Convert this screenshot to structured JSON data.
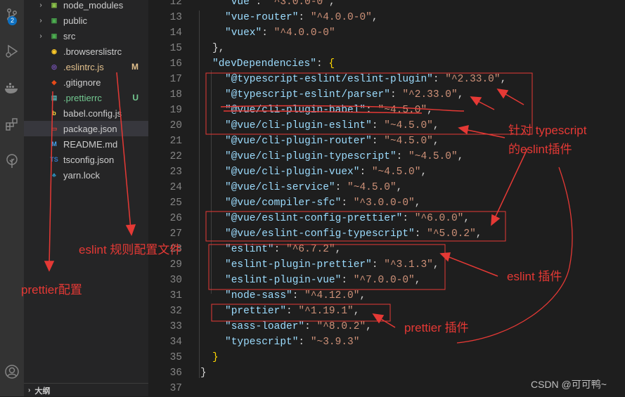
{
  "activity_bar": {
    "scm_badge": "2",
    "icons": [
      "source-control-icon",
      "run-debug-icon",
      "docker-icon",
      "extensions-icon",
      "tree-icon",
      "account-icon"
    ]
  },
  "explorer": {
    "items": [
      {
        "name": "node_modules",
        "type": "folder",
        "status": ""
      },
      {
        "name": "public",
        "type": "folder",
        "status": ""
      },
      {
        "name": "src",
        "type": "folder",
        "status": ""
      },
      {
        "name": ".browserslistrc",
        "type": "file",
        "status": ""
      },
      {
        "name": ".eslintrc.js",
        "type": "file",
        "status": "M"
      },
      {
        "name": ".gitignore",
        "type": "file",
        "status": ""
      },
      {
        "name": ".prettierrc",
        "type": "file",
        "status": "U"
      },
      {
        "name": "babel.config.js",
        "type": "file",
        "status": ""
      },
      {
        "name": "package.json",
        "type": "file",
        "status": ""
      },
      {
        "name": "README.md",
        "type": "file",
        "status": ""
      },
      {
        "name": "tsconfig.json",
        "type": "file",
        "status": ""
      },
      {
        "name": "yarn.lock",
        "type": "file",
        "status": ""
      }
    ],
    "outline_label": "大纲",
    "colors": {
      "modified": "#e2c08d",
      "untracked": "#73c991",
      "prettierrc_name": "#73c991"
    }
  },
  "editor": {
    "lines": [
      {
        "num": "12",
        "key": "\"vue\"",
        "value": "\"^3.0.0-0\"",
        "trail": ","
      },
      {
        "num": "13",
        "key": "\"vue-router\"",
        "value": "\"^4.0.0-0\"",
        "trail": ","
      },
      {
        "num": "14",
        "key": "\"vuex\"",
        "value": "\"^4.0.0-0\"",
        "trail": ""
      },
      {
        "num": "15",
        "text": "},"
      },
      {
        "num": "16",
        "key": "\"devDependencies\"",
        "value": "{",
        "trail": ""
      },
      {
        "num": "17",
        "key": "\"@typescript-eslint/eslint-plugin\"",
        "value": "\"^2.33.0\"",
        "trail": ","
      },
      {
        "num": "18",
        "key": "\"@typescript-eslint/parser\"",
        "value": "\"^2.33.0\"",
        "trail": ","
      },
      {
        "num": "19",
        "key": "\"@vue/cli-plugin-babel\"",
        "value": "\"~4.5.0\"",
        "trail": ","
      },
      {
        "num": "20",
        "key": "\"@vue/cli-plugin-eslint\"",
        "value": "\"~4.5.0\"",
        "trail": ","
      },
      {
        "num": "21",
        "key": "\"@vue/cli-plugin-router\"",
        "value": "\"~4.5.0\"",
        "trail": ","
      },
      {
        "num": "22",
        "key": "\"@vue/cli-plugin-typescript\"",
        "value": "\"~4.5.0\"",
        "trail": ","
      },
      {
        "num": "23",
        "key": "\"@vue/cli-plugin-vuex\"",
        "value": "\"~4.5.0\"",
        "trail": ","
      },
      {
        "num": "24",
        "key": "\"@vue/cli-service\"",
        "value": "\"~4.5.0\"",
        "trail": ","
      },
      {
        "num": "25",
        "key": "\"@vue/compiler-sfc\"",
        "value": "\"^3.0.0-0\"",
        "trail": ","
      },
      {
        "num": "26",
        "key": "\"@vue/eslint-config-prettier\"",
        "value": "\"^6.0.0\"",
        "trail": ","
      },
      {
        "num": "27",
        "key": "\"@vue/eslint-config-typescript\"",
        "value": "\"^5.0.2\"",
        "trail": ","
      },
      {
        "num": "28",
        "key": "\"eslint\"",
        "value": "\"^6.7.2\"",
        "trail": ","
      },
      {
        "num": "29",
        "key": "\"eslint-plugin-prettier\"",
        "value": "\"^3.1.3\"",
        "trail": ","
      },
      {
        "num": "30",
        "key": "\"eslint-plugin-vue\"",
        "value": "\"^7.0.0-0\"",
        "trail": ","
      },
      {
        "num": "31",
        "key": "\"node-sass\"",
        "value": "\"^4.12.0\"",
        "trail": ","
      },
      {
        "num": "32",
        "key": "\"prettier\"",
        "value": "\"^1.19.1\"",
        "trail": ","
      },
      {
        "num": "33",
        "key": "\"sass-loader\"",
        "value": "\"^8.0.2\"",
        "trail": ","
      },
      {
        "num": "34",
        "key": "\"typescript\"",
        "value": "\"~3.9.3\"",
        "trail": ""
      },
      {
        "num": "35",
        "text": "}"
      },
      {
        "num": "36",
        "text": "}"
      },
      {
        "num": "37",
        "text": ""
      }
    ],
    "colors": {
      "key": "#9cdcfe",
      "string": "#ce9178",
      "punct": "#d4d4d4",
      "bracket": "#ffd700",
      "line_number": "#858585"
    }
  },
  "annotations": {
    "ts_eslint_line1": "针对 typescript",
    "ts_eslint_line2": "的eslint插件",
    "eslint_rules_file": "eslint 规则配置文件",
    "prettier_config": "prettier配置",
    "eslint_plugin": "eslint 插件",
    "prettier_plugin": "prettier 插件",
    "color": "#e53935"
  },
  "watermark": "CSDN @可可鸭~"
}
